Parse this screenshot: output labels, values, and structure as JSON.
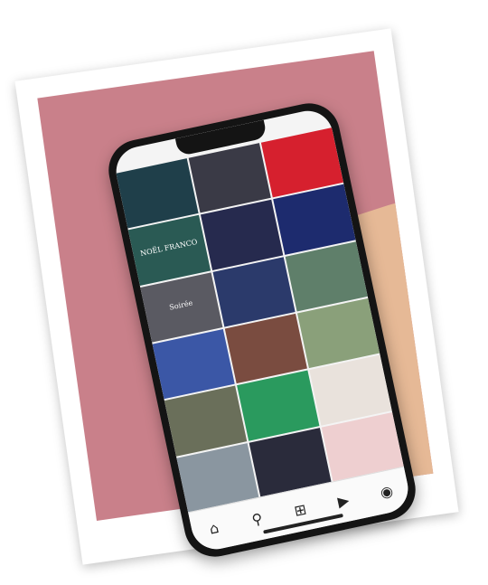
{
  "scene": {
    "background_color": "#c9808a",
    "nail_color": "#24403c"
  },
  "tiles": [
    {
      "color": "#1f3f4a",
      "text": ""
    },
    {
      "color": "#3a3a46",
      "text": ""
    },
    {
      "color": "#d6202e",
      "text": ""
    },
    {
      "color": "#2a5a54",
      "text": "NOËL FRANCO"
    },
    {
      "color": "#262a4e",
      "text": ""
    },
    {
      "color": "#1d2b6e",
      "text": ""
    },
    {
      "color": "#5a5a62",
      "text": "Soirée"
    },
    {
      "color": "#2b3a6b",
      "text": ""
    },
    {
      "color": "#5f7f6a",
      "text": ""
    },
    {
      "color": "#3b57a6",
      "text": ""
    },
    {
      "color": "#7a4c40",
      "text": ""
    },
    {
      "color": "#8aa07a",
      "text": ""
    },
    {
      "color": "#6a6f5a",
      "text": ""
    },
    {
      "color": "#2a9a5e",
      "text": ""
    },
    {
      "color": "#e9e2dc",
      "text": ""
    },
    {
      "color": "#8a96a0",
      "text": ""
    },
    {
      "color": "#2a2b3b",
      "text": ""
    },
    {
      "color": "#eecfd0",
      "text": ""
    }
  ],
  "nav": {
    "icons": [
      "home-icon",
      "search-icon",
      "create-icon",
      "reels-icon",
      "profile-icon"
    ]
  }
}
